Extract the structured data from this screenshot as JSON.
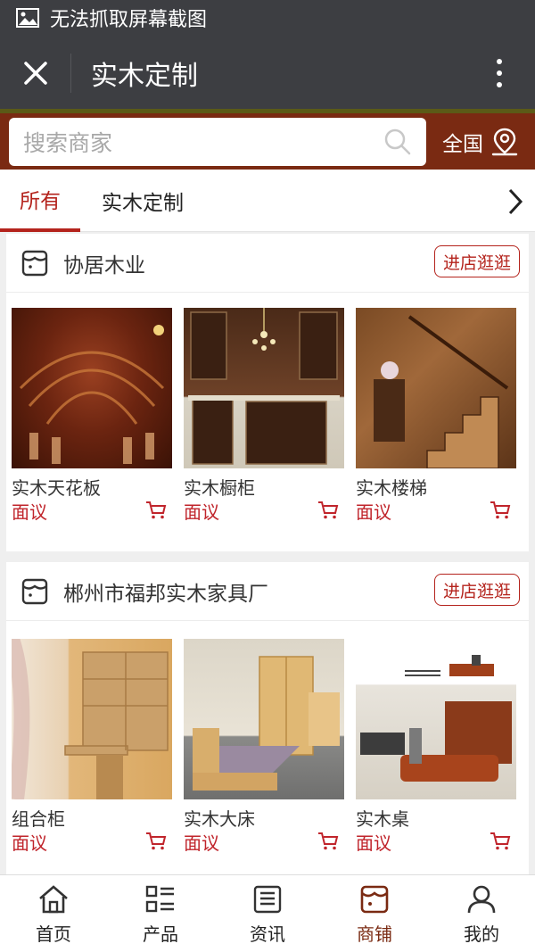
{
  "status": {
    "text": "无法抓取屏幕截图",
    "icon": "image-icon"
  },
  "titlebar": {
    "title": "实木定制",
    "close_icon": "close-icon",
    "more_icon": "more-vertical-icon"
  },
  "search": {
    "placeholder": "搜索商家",
    "region": "全国",
    "region_icon": "location-icon"
  },
  "tabs": [
    {
      "label": "所有",
      "active": true
    },
    {
      "label": "实木定制",
      "active": false
    }
  ],
  "stores": [
    {
      "name": "协居木业",
      "enter_label": "进店逛逛",
      "products": [
        {
          "name": "实木天花板",
          "price": "面议"
        },
        {
          "name": "实木橱柜",
          "price": "面议"
        },
        {
          "name": "实木楼梯",
          "price": "面议"
        }
      ]
    },
    {
      "name": "郴州市福邦实木家具厂",
      "enter_label": "进店逛逛",
      "products": [
        {
          "name": "组合柜",
          "price": "面议"
        },
        {
          "name": "实木大床",
          "price": "面议"
        },
        {
          "name": "实木桌",
          "price": "面议"
        }
      ]
    }
  ],
  "bottom_nav": [
    {
      "label": "首页",
      "icon": "home-icon"
    },
    {
      "label": "产品",
      "icon": "grid-list-icon"
    },
    {
      "label": "资讯",
      "icon": "news-icon"
    },
    {
      "label": "商铺",
      "icon": "shop-icon",
      "active": true
    },
    {
      "label": "我的",
      "icon": "user-icon"
    }
  ],
  "colors": {
    "accent": "#b4231c",
    "brand": "#7a2a12",
    "topbar": "#3d3e42"
  }
}
